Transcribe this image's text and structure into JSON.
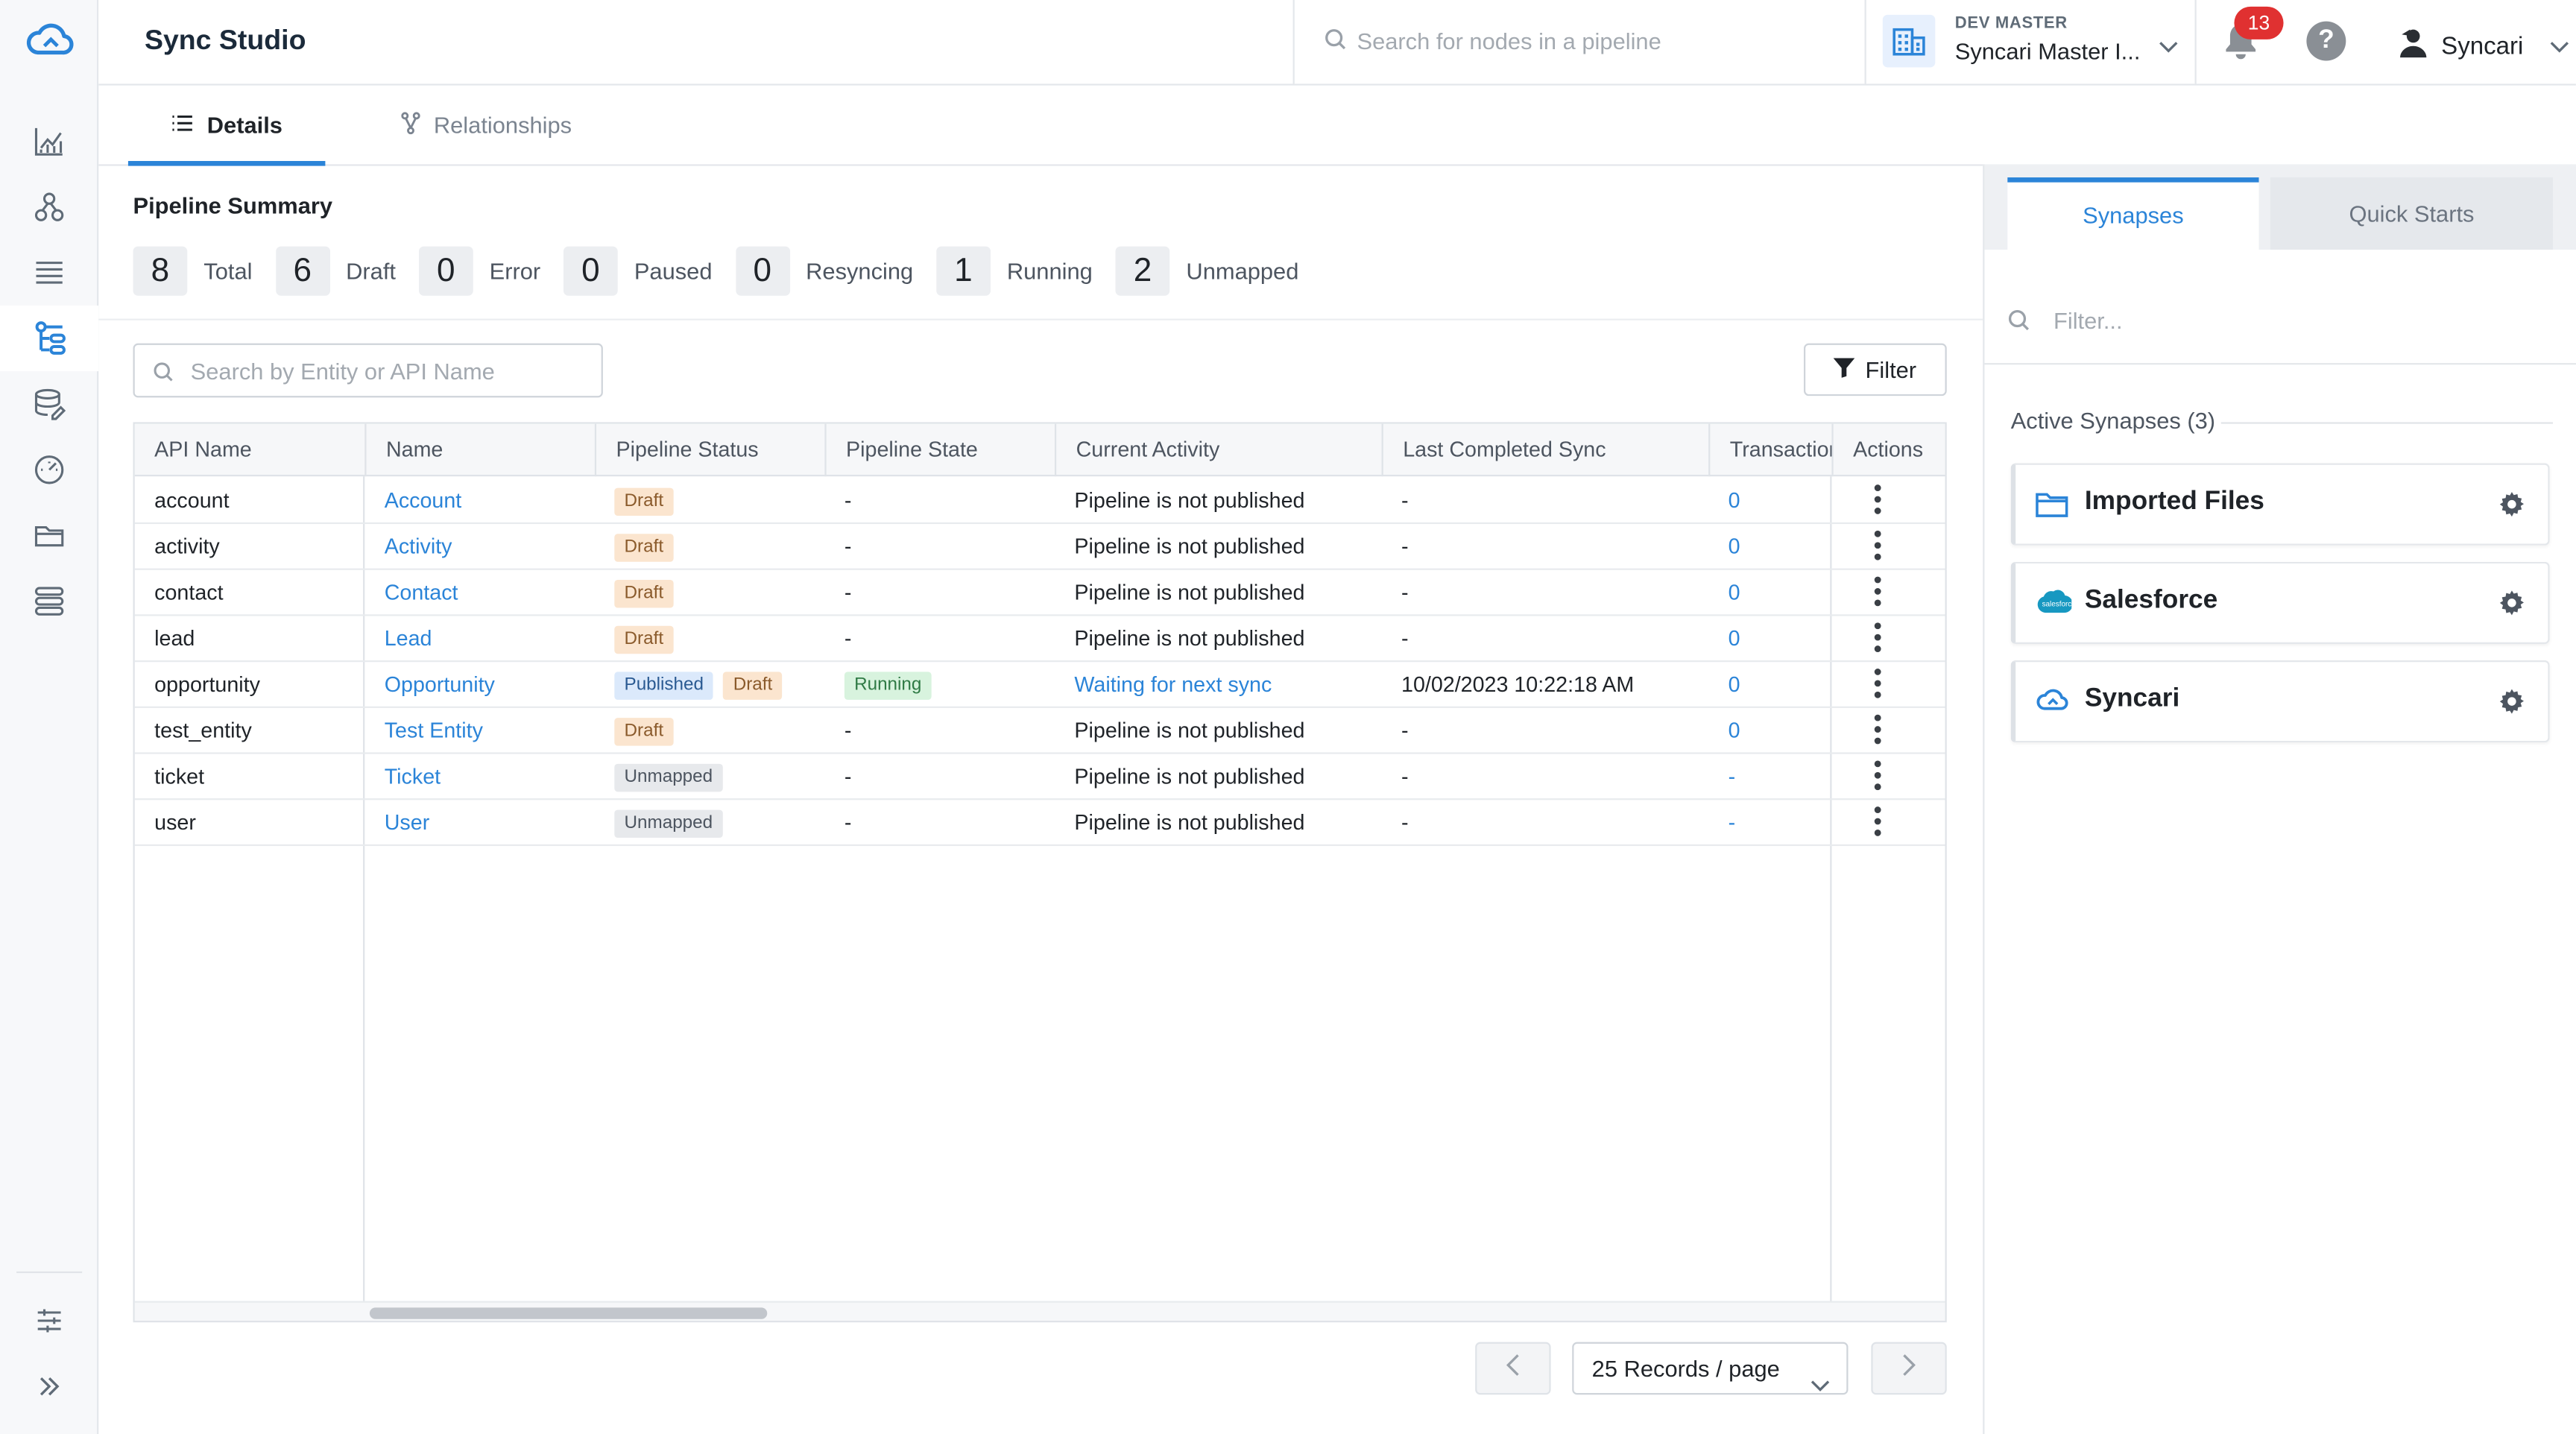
{
  "app": {
    "title": "Sync Studio"
  },
  "header": {
    "search_placeholder": "Search for nodes in a pipeline",
    "org_label": "DEV MASTER",
    "org_value": "Syncari Master I...",
    "notifications": "13",
    "help": "?",
    "user": "Syncari"
  },
  "tabs": [
    {
      "label": "Details",
      "active": true,
      "icon": "list-icon"
    },
    {
      "label": "Relationships",
      "active": false,
      "icon": "relationships-icon"
    }
  ],
  "summary": {
    "title": "Pipeline Summary",
    "items": [
      {
        "count": "8",
        "label": "Total"
      },
      {
        "count": "6",
        "label": "Draft"
      },
      {
        "count": "0",
        "label": "Error"
      },
      {
        "count": "0",
        "label": "Paused"
      },
      {
        "count": "0",
        "label": "Resyncing"
      },
      {
        "count": "1",
        "label": "Running"
      },
      {
        "count": "2",
        "label": "Unmapped"
      }
    ]
  },
  "table": {
    "search_placeholder": "Search by Entity or API Name",
    "filter_label": "Filter",
    "columns": [
      "API Name",
      "Name",
      "Pipeline Status",
      "Pipeline State",
      "Current Activity",
      "Last Completed Sync",
      "Transactions",
      "Actions"
    ],
    "rows": [
      {
        "api": "account",
        "name": "Account",
        "status": [
          "Draft"
        ],
        "state": "-",
        "activity": "Pipeline is not published",
        "last_sync": "-",
        "tx": "0"
      },
      {
        "api": "activity",
        "name": "Activity",
        "status": [
          "Draft"
        ],
        "state": "-",
        "activity": "Pipeline is not published",
        "last_sync": "-",
        "tx": "0"
      },
      {
        "api": "contact",
        "name": "Contact",
        "status": [
          "Draft"
        ],
        "state": "-",
        "activity": "Pipeline is not published",
        "last_sync": "-",
        "tx": "0"
      },
      {
        "api": "lead",
        "name": "Lead",
        "status": [
          "Draft"
        ],
        "state": "-",
        "activity": "Pipeline is not published",
        "last_sync": "-",
        "tx": "0"
      },
      {
        "api": "opportunity",
        "name": "Opportunity",
        "status": [
          "Published",
          "Draft"
        ],
        "state": "Running",
        "activity": "Waiting for next sync",
        "last_sync": "10/02/2023 10:22:18 AM",
        "tx": "0"
      },
      {
        "api": "test_entity",
        "name": "Test Entity",
        "status": [
          "Draft"
        ],
        "state": "-",
        "activity": "Pipeline is not published",
        "last_sync": "-",
        "tx": "0"
      },
      {
        "api": "ticket",
        "name": "Ticket",
        "status": [
          "Unmapped"
        ],
        "state": "-",
        "activity": "Pipeline is not published",
        "last_sync": "-",
        "tx": "-"
      },
      {
        "api": "user",
        "name": "User",
        "status": [
          "Unmapped"
        ],
        "state": "-",
        "activity": "Pipeline is not published",
        "last_sync": "-",
        "tx": "-"
      }
    ]
  },
  "pagination": {
    "page_size": "25 Records / page"
  },
  "right_panel": {
    "tabs": [
      "Synapses",
      "Quick Starts"
    ],
    "filter_placeholder": "Filter...",
    "active_title": "Active Synapses (3)",
    "synapses": [
      {
        "name": "Imported Files",
        "icon": "folder-icon"
      },
      {
        "name": "Salesforce",
        "icon": "salesforce-icon"
      },
      {
        "name": "Syncari",
        "icon": "syncari-cloud-icon"
      }
    ]
  },
  "colors": {
    "accent": "#2b84d8",
    "draft": "#fbe5cf",
    "running": "#d8f3de",
    "published": "#dbe9fb",
    "badge": "#e03131"
  }
}
